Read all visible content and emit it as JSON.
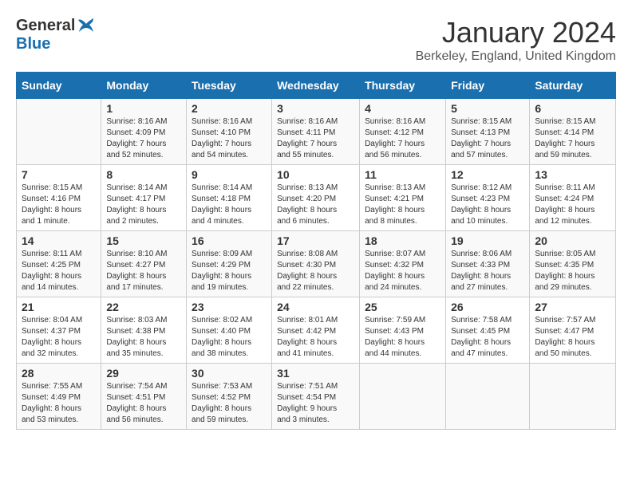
{
  "header": {
    "logo_general": "General",
    "logo_blue": "Blue",
    "month_title": "January 2024",
    "location": "Berkeley, England, United Kingdom"
  },
  "columns": [
    "Sunday",
    "Monday",
    "Tuesday",
    "Wednesday",
    "Thursday",
    "Friday",
    "Saturday"
  ],
  "weeks": [
    [
      {
        "day": "",
        "info": ""
      },
      {
        "day": "1",
        "info": "Sunrise: 8:16 AM\nSunset: 4:09 PM\nDaylight: 7 hours\nand 52 minutes."
      },
      {
        "day": "2",
        "info": "Sunrise: 8:16 AM\nSunset: 4:10 PM\nDaylight: 7 hours\nand 54 minutes."
      },
      {
        "day": "3",
        "info": "Sunrise: 8:16 AM\nSunset: 4:11 PM\nDaylight: 7 hours\nand 55 minutes."
      },
      {
        "day": "4",
        "info": "Sunrise: 8:16 AM\nSunset: 4:12 PM\nDaylight: 7 hours\nand 56 minutes."
      },
      {
        "day": "5",
        "info": "Sunrise: 8:15 AM\nSunset: 4:13 PM\nDaylight: 7 hours\nand 57 minutes."
      },
      {
        "day": "6",
        "info": "Sunrise: 8:15 AM\nSunset: 4:14 PM\nDaylight: 7 hours\nand 59 minutes."
      }
    ],
    [
      {
        "day": "7",
        "info": "Sunrise: 8:15 AM\nSunset: 4:16 PM\nDaylight: 8 hours\nand 1 minute."
      },
      {
        "day": "8",
        "info": "Sunrise: 8:14 AM\nSunset: 4:17 PM\nDaylight: 8 hours\nand 2 minutes."
      },
      {
        "day": "9",
        "info": "Sunrise: 8:14 AM\nSunset: 4:18 PM\nDaylight: 8 hours\nand 4 minutes."
      },
      {
        "day": "10",
        "info": "Sunrise: 8:13 AM\nSunset: 4:20 PM\nDaylight: 8 hours\nand 6 minutes."
      },
      {
        "day": "11",
        "info": "Sunrise: 8:13 AM\nSunset: 4:21 PM\nDaylight: 8 hours\nand 8 minutes."
      },
      {
        "day": "12",
        "info": "Sunrise: 8:12 AM\nSunset: 4:23 PM\nDaylight: 8 hours\nand 10 minutes."
      },
      {
        "day": "13",
        "info": "Sunrise: 8:11 AM\nSunset: 4:24 PM\nDaylight: 8 hours\nand 12 minutes."
      }
    ],
    [
      {
        "day": "14",
        "info": "Sunrise: 8:11 AM\nSunset: 4:25 PM\nDaylight: 8 hours\nand 14 minutes."
      },
      {
        "day": "15",
        "info": "Sunrise: 8:10 AM\nSunset: 4:27 PM\nDaylight: 8 hours\nand 17 minutes."
      },
      {
        "day": "16",
        "info": "Sunrise: 8:09 AM\nSunset: 4:29 PM\nDaylight: 8 hours\nand 19 minutes."
      },
      {
        "day": "17",
        "info": "Sunrise: 8:08 AM\nSunset: 4:30 PM\nDaylight: 8 hours\nand 22 minutes."
      },
      {
        "day": "18",
        "info": "Sunrise: 8:07 AM\nSunset: 4:32 PM\nDaylight: 8 hours\nand 24 minutes."
      },
      {
        "day": "19",
        "info": "Sunrise: 8:06 AM\nSunset: 4:33 PM\nDaylight: 8 hours\nand 27 minutes."
      },
      {
        "day": "20",
        "info": "Sunrise: 8:05 AM\nSunset: 4:35 PM\nDaylight: 8 hours\nand 29 minutes."
      }
    ],
    [
      {
        "day": "21",
        "info": "Sunrise: 8:04 AM\nSunset: 4:37 PM\nDaylight: 8 hours\nand 32 minutes."
      },
      {
        "day": "22",
        "info": "Sunrise: 8:03 AM\nSunset: 4:38 PM\nDaylight: 8 hours\nand 35 minutes."
      },
      {
        "day": "23",
        "info": "Sunrise: 8:02 AM\nSunset: 4:40 PM\nDaylight: 8 hours\nand 38 minutes."
      },
      {
        "day": "24",
        "info": "Sunrise: 8:01 AM\nSunset: 4:42 PM\nDaylight: 8 hours\nand 41 minutes."
      },
      {
        "day": "25",
        "info": "Sunrise: 7:59 AM\nSunset: 4:43 PM\nDaylight: 8 hours\nand 44 minutes."
      },
      {
        "day": "26",
        "info": "Sunrise: 7:58 AM\nSunset: 4:45 PM\nDaylight: 8 hours\nand 47 minutes."
      },
      {
        "day": "27",
        "info": "Sunrise: 7:57 AM\nSunset: 4:47 PM\nDaylight: 8 hours\nand 50 minutes."
      }
    ],
    [
      {
        "day": "28",
        "info": "Sunrise: 7:55 AM\nSunset: 4:49 PM\nDaylight: 8 hours\nand 53 minutes."
      },
      {
        "day": "29",
        "info": "Sunrise: 7:54 AM\nSunset: 4:51 PM\nDaylight: 8 hours\nand 56 minutes."
      },
      {
        "day": "30",
        "info": "Sunrise: 7:53 AM\nSunset: 4:52 PM\nDaylight: 8 hours\nand 59 minutes."
      },
      {
        "day": "31",
        "info": "Sunrise: 7:51 AM\nSunset: 4:54 PM\nDaylight: 9 hours\nand 3 minutes."
      },
      {
        "day": "",
        "info": ""
      },
      {
        "day": "",
        "info": ""
      },
      {
        "day": "",
        "info": ""
      }
    ]
  ]
}
